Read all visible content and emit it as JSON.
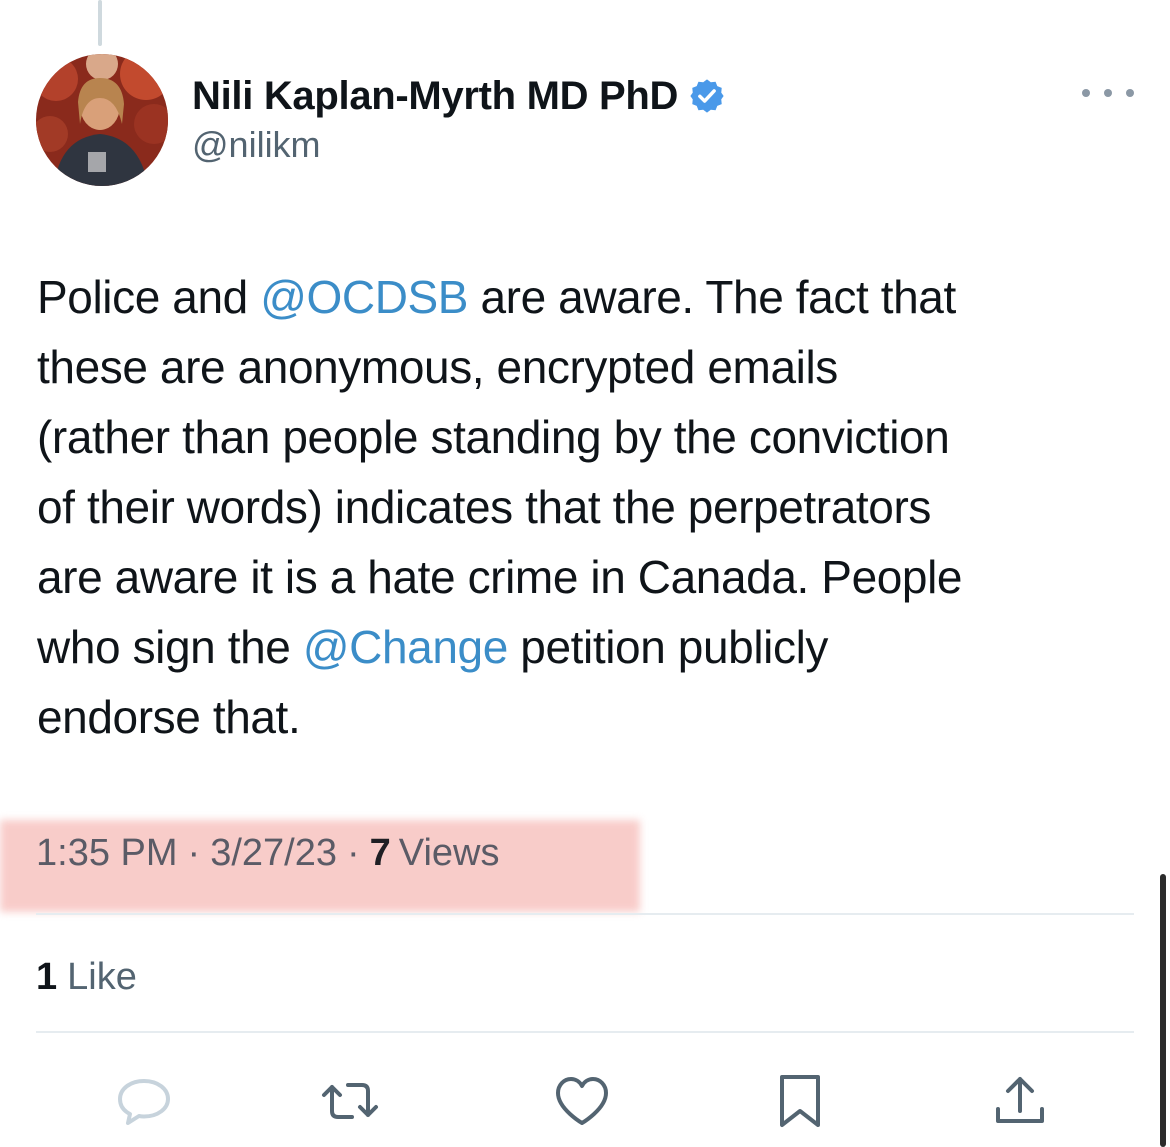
{
  "author": {
    "display_name": "Nili Kaplan-Myrth MD PhD",
    "handle": "@nilikm",
    "verified": true
  },
  "tweet": {
    "lines": [
      [
        {
          "t": "Police and "
        },
        {
          "t": "@OCDSB",
          "mention": true
        },
        {
          "t": " are aware. The fact that"
        }
      ],
      [
        {
          "t": "these are anonymous, encrypted emails"
        }
      ],
      [
        {
          "t": "(rather than people standing by the conviction"
        }
      ],
      [
        {
          "t": "of their words) indicates that the perpetrators"
        }
      ],
      [
        {
          "t": "are aware it is a hate crime in Canada. People"
        }
      ],
      [
        {
          "t": "who sign the "
        },
        {
          "t": "@Change",
          "mention": true
        },
        {
          "t": " petition publicly"
        }
      ],
      [
        {
          "t": "endorse that."
        }
      ]
    ]
  },
  "meta": {
    "time": "1:35 PM",
    "separator": "·",
    "date": "3/27/23",
    "views_count": "7",
    "views_label": "Views"
  },
  "engagement": {
    "likes_count": "1",
    "likes_label": "Like"
  },
  "actions": [
    {
      "name": "reply-icon"
    },
    {
      "name": "retweet-icon"
    },
    {
      "name": "like-icon"
    },
    {
      "name": "bookmark-icon"
    },
    {
      "name": "share-icon"
    }
  ],
  "colors": {
    "mention": "#3b8dc8",
    "verified": "#4a99e9",
    "highlight": "#f8c7c4",
    "secondary_text": "#536471"
  }
}
